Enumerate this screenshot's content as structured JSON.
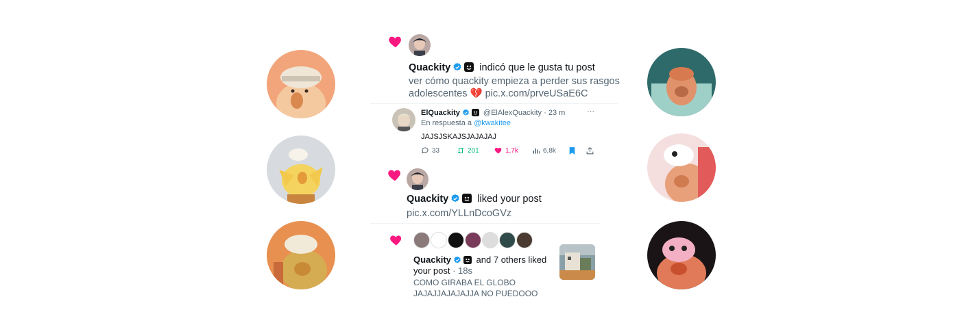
{
  "colors": {
    "heart": "#f91880",
    "verified": "#1d9bf0",
    "muted": "#536471",
    "link": "#1d9bf0",
    "retweet": "#00ba7c"
  },
  "side_avatars": [
    {
      "name": "duck-avatar-1",
      "bg": "#f2a57a",
      "accent": "#f5c9a0"
    },
    {
      "name": "duck-avatar-2",
      "bg": "#d7dbe0",
      "accent": "#f4d35e"
    },
    {
      "name": "duck-avatar-3",
      "bg": "#e89050",
      "accent": "#d6ac52"
    },
    {
      "name": "duck-avatar-4",
      "bg": "#2e6a6a",
      "accent": "#e0926a"
    },
    {
      "name": "duck-avatar-5",
      "bg": "#f0c0c0",
      "accent": "#e8a07a"
    },
    {
      "name": "duck-avatar-6",
      "bg": "#1a1416",
      "accent": "#f3b0c4"
    }
  ],
  "notif1": {
    "name": "Quackity",
    "action": "indicó que le gusta tu post",
    "post_line1": "ver cómo quackity empieza a perder sus rasgos",
    "post_line2": "adolescentes",
    "broken_heart": "💔",
    "link": "pic.x.com/prveUSaE6C"
  },
  "reply": {
    "name": "ElQuackity",
    "handle": "@ElAlexQuackity",
    "time": "· 23 m",
    "more": "···",
    "reply_to_label": "En respuesta a",
    "reply_to_user": "@kwakitee",
    "text": "JAJSJSKAJSJAJAJAJ",
    "replies": "33",
    "retweets": "201",
    "likes": "1,7k",
    "views": "6,8k"
  },
  "notif2": {
    "name": "Quackity",
    "action": "liked your post",
    "link": "pic.x.com/YLLnDcoGVz"
  },
  "notif3": {
    "name": "Quackity",
    "action_line1": "and 7 others liked",
    "action_line2_a": "your post",
    "action_line2_b": "· 18s",
    "post_line1": "COMO GIRABA EL GLOBO",
    "post_line2": "JAJAJJAJAJAJJA NO PUEDOOO",
    "liker_avatars": [
      "#8a7a7a",
      "#ffffff",
      "#111111",
      "#7a3a5a",
      "#dddddd",
      "#2f4a48",
      "#4a3a30"
    ]
  }
}
